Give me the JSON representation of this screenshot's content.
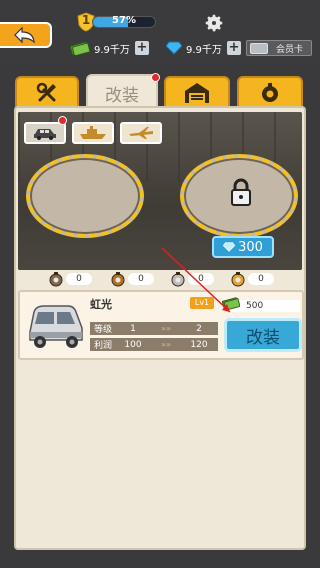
{
  "hud": {
    "level": "1",
    "xp_percent": 57,
    "xp_label": "57%",
    "cash": "9.9千万",
    "gems": "9.9千万",
    "vip_label": "会员卡"
  },
  "tabs": [
    {
      "label": ""
    },
    {
      "label": "改装"
    },
    {
      "label": ""
    },
    {
      "label": ""
    }
  ],
  "garage": {
    "unlock_cost": "300"
  },
  "parts": [
    {
      "count": "0"
    },
    {
      "count": "0"
    },
    {
      "count": "0"
    },
    {
      "count": "0"
    }
  ],
  "vehicle": {
    "name": "虹光",
    "level_badge": "Lv1",
    "stats": [
      {
        "label": "等级",
        "current": "1",
        "next": "2"
      },
      {
        "label": "利润",
        "current": "100",
        "next": "120"
      }
    ],
    "upgrade_cost": "500",
    "modify_label": "改装"
  },
  "colors": {
    "accent": "#f5b51e",
    "button_blue": "#38a9d6",
    "background": "#3a3a3c"
  }
}
